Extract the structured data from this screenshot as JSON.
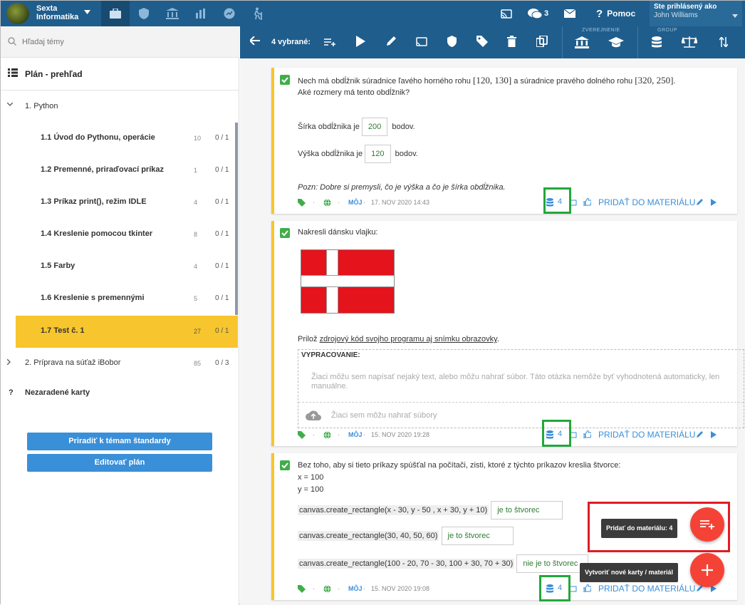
{
  "topbar": {
    "brand_line1": "Sexta",
    "brand_line2": "Informatika",
    "messages_count": "3",
    "help_label": "Pomoc",
    "user_label": "Ste prihlásený ako",
    "user_name": "John Williams"
  },
  "sidebar": {
    "search_placeholder": "Hľadaj témy",
    "plan_title": "Plán - prehľad",
    "section1": "1. Python",
    "items": [
      {
        "label": "1.1 Úvod do Pythonu, operácie",
        "count": "10",
        "progress": "0 / 1"
      },
      {
        "label": "1.2 Premenné, priraďovací príkaz",
        "count": "1",
        "progress": "0 / 1"
      },
      {
        "label": "1.3 Príkaz print(), režim IDLE",
        "count": "4",
        "progress": "0 / 1"
      },
      {
        "label": "1.4 Kreslenie pomocou tkinter",
        "count": "8",
        "progress": "0 / 1"
      },
      {
        "label": "1.5 Farby",
        "count": "4",
        "progress": "0 / 1"
      },
      {
        "label": "1.6 Kreslenie s premennými",
        "count": "5",
        "progress": "0 / 1"
      },
      {
        "label": "1.7 Test č. 1",
        "count": "27",
        "progress": "0 / 1"
      }
    ],
    "section2": "2. Príprava na súťaž iBobor",
    "section2_count": "85",
    "section2_progress": "0 / 3",
    "unassigned_mark": "?",
    "unassigned": "Nezaradené karty",
    "btn_assign": "Priradiť k témam štandardy",
    "btn_edit": "Editovať plán"
  },
  "toolbar": {
    "selected": "4 vybrané:",
    "group_publish": "ZVEREJNENIE",
    "group_group": "GROUP"
  },
  "cards": [
    {
      "q_line1_a": "Nech má obdĺžnik súradnice ľavého horného rohu",
      "q_math1": "[120, 130]",
      "q_line1_b": "a súradnice pravého dolného rohu",
      "q_math2": "[320, 250]",
      "q_line1_c": ".",
      "q_line2": "Aké rozmery má tento obdĺžnik?",
      "width_prefix": "Šírka obdĺžnika je",
      "width_value": "200",
      "width_suffix": "bodov.",
      "height_prefix": "Výška obdĺžnika je",
      "height_value": "120",
      "height_suffix": "bodov.",
      "note": "Pozn: Dobre si premysli, čo je výška a čo je šírka obdĺžnika.",
      "author": "MÔJ",
      "date": "17. NOV 2020 14:43",
      "count": "4",
      "add": "PRIDAŤ DO MATERIÁLU"
    },
    {
      "q": "Nakresli dánsku vlajku:",
      "attach_prefix": "Prilož",
      "attach_link": "zdrojový kód svojho programu aj snímku obrazovky",
      "attach_suffix": ".",
      "answer_title": "VYPRACOVANIE:",
      "answer_placeholder": "Žiaci môžu sem napísať nejaký text, alebo môžu nahrať súbor. Táto otázka nemôže byť vyhodnotená automaticky, len manuálne.",
      "upload": "Žiaci sem môžu nahrať súbory",
      "author": "MÔJ",
      "date": "15. NOV 2020 19:28",
      "count": "4",
      "add": "PRIDAŤ DO MATERIÁLU"
    },
    {
      "q": "Bez toho, aby si tieto príkazy spúšťal na počítači, zisti, ktoré z týchto príkazov kreslia štvorce:",
      "x": "x = 100",
      "y": "y = 100",
      "rows": [
        {
          "code": "canvas.create_rectangle(x - 30, y - 50 , x + 30, y + 10)",
          "answer": "je to štvorec"
        },
        {
          "code": "canvas.create_rectangle(30, 40, 50, 60)",
          "answer": "je to štvorec"
        },
        {
          "code": "canvas.create_rectangle(100 - 20, 70 - 30, 100 + 30, 70 + 30)",
          "answer": "nie je to štvorec"
        }
      ],
      "author": "MÔJ",
      "date": "15. NOV 2020 19:08",
      "count": "4",
      "add": "PRIDAŤ DO MATERIÁLU"
    }
  ],
  "fab": {
    "add_tooltip": "Pridať do materiálu: 4",
    "new_tooltip": "Vytvoriť nové karty / materiál"
  },
  "colors": {
    "topbar": "#1f5d8c",
    "accent": "#3a8fd9",
    "active": "#f7c52d",
    "fab": "#f44336",
    "highlight_green": "#22a83a",
    "highlight_red": "#e01b24"
  }
}
